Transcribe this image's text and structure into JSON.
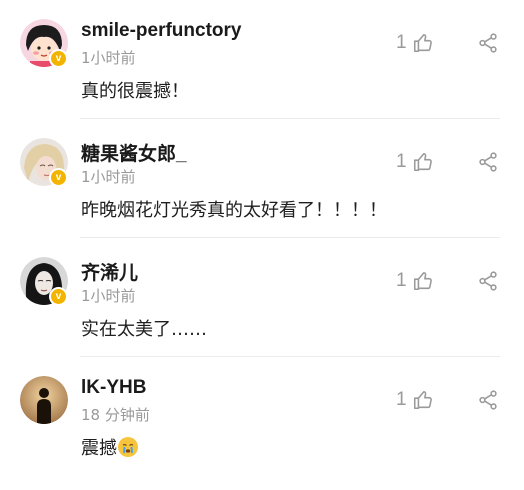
{
  "comments": [
    {
      "username": "smile-perfunctory",
      "time": "1小时前",
      "text": "真的很震撼！",
      "likes": "1",
      "verified": true,
      "avatar": "cartoon-girl-avatar"
    },
    {
      "username": "糖果酱女郎_",
      "time": "1小时前",
      "text": "昨晚烟花灯光秀真的太好看了！！！！",
      "likes": "1",
      "verified": true,
      "avatar": "blonde-girl-avatar"
    },
    {
      "username": "齐浠儿",
      "time": "1小时前",
      "text": "实在太美了……",
      "likes": "1",
      "verified": true,
      "avatar": "dark-hair-girl-avatar"
    },
    {
      "username": "lK-YHB",
      "time": "18 分钟前",
      "text": "震撼",
      "likes": "1",
      "verified": false,
      "avatar": "silhouette-avatar",
      "emoji": "crying-face-emoji"
    }
  ],
  "colors": {
    "badge": "#f3b400",
    "meta": "#9a9a9a",
    "divider": "#ececec"
  }
}
